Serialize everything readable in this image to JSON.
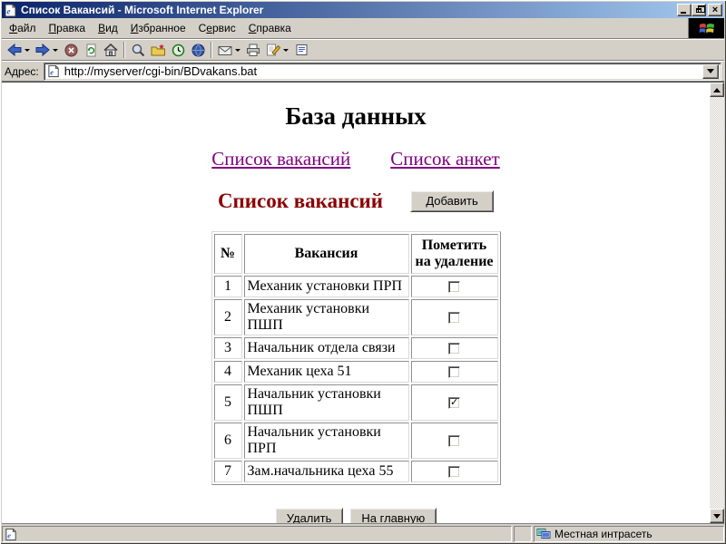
{
  "window": {
    "title": "Список Вакансий - Microsoft Internet Explorer"
  },
  "menu": {
    "items": [
      {
        "pre": "",
        "accel": "Ф",
        "post": "айл"
      },
      {
        "pre": "",
        "accel": "П",
        "post": "равка"
      },
      {
        "pre": "",
        "accel": "В",
        "post": "ид"
      },
      {
        "pre": "",
        "accel": "И",
        "post": "збранное"
      },
      {
        "pre": "С",
        "accel": "е",
        "post": "рвис"
      },
      {
        "pre": "",
        "accel": "С",
        "post": "правка"
      }
    ]
  },
  "toolbar": {
    "icons": [
      "back",
      "forward",
      "stop",
      "refresh",
      "home",
      "search",
      "favorites",
      "history",
      "messenger",
      "mail",
      "print",
      "edit",
      "discuss"
    ]
  },
  "address": {
    "label_pre": "А",
    "label_accel": "д",
    "label_post": "рес:",
    "url": "http://myserver/cgi-bin/BDvakans.bat"
  },
  "page": {
    "heading": "База данных",
    "links": [
      {
        "label": "Список вакансий"
      },
      {
        "label": "Список анкет"
      }
    ],
    "section_title": "Список вакансий",
    "add_button": "Добавить",
    "table": {
      "headers": [
        "№",
        "Вакансия",
        "Пометить на удаление"
      ],
      "rows": [
        {
          "num": "1",
          "vacancy": "Механик установки ПРП",
          "checked": false
        },
        {
          "num": "2",
          "vacancy": "Механик установки ПШП",
          "checked": false
        },
        {
          "num": "3",
          "vacancy": "Начальник отдела связи",
          "checked": false
        },
        {
          "num": "4",
          "vacancy": "Механик цеха 51",
          "checked": false
        },
        {
          "num": "5",
          "vacancy": "Начальник установки ПШП",
          "checked": true
        },
        {
          "num": "6",
          "vacancy": "Начальник установки ПРП",
          "checked": false
        },
        {
          "num": "7",
          "vacancy": "Зам.начальника цеха 55",
          "checked": false
        }
      ]
    },
    "delete_button": "Удалить",
    "home_button": "На главную"
  },
  "status": {
    "zone": "Местная интрасеть"
  },
  "colors": {
    "title_gradient_start": "#0a246a",
    "title_gradient_end": "#a6caf0",
    "chrome": "#d4d0c8",
    "link": "#800080",
    "section_title": "#8b0000"
  }
}
